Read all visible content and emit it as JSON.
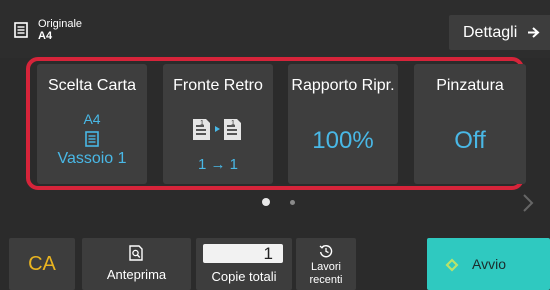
{
  "original": {
    "label": "Originale",
    "value": "A4",
    "icon": "document-icon"
  },
  "header": {
    "details_label": "Dettagli",
    "details_icon": "arrow-right-icon"
  },
  "tiles": [
    {
      "title": "Scelta Carta",
      "value": "A4",
      "sub": "Vassoio 1",
      "icon": "paper-tray-icon"
    },
    {
      "title": "Fronte Retro",
      "sub": "1 → 1",
      "icon": "duplex-1-to-1-icon"
    },
    {
      "title": "Rapporto Ripr.",
      "value": "100%"
    },
    {
      "title": "Pinzatura",
      "value": "Off"
    }
  ],
  "pager": {
    "pages": 2,
    "current": 1
  },
  "bottom": {
    "ca_label": "CA",
    "preview_label": "Anteprima",
    "copies_value": "1",
    "copies_label": "Copie totali",
    "recent_label": "Lavori recenti",
    "start_label": "Avvio"
  },
  "colors": {
    "highlight": "#d6243a",
    "accent_blue": "#49b8e6",
    "start": "#2fc9c0",
    "ca": "#e9b420"
  }
}
